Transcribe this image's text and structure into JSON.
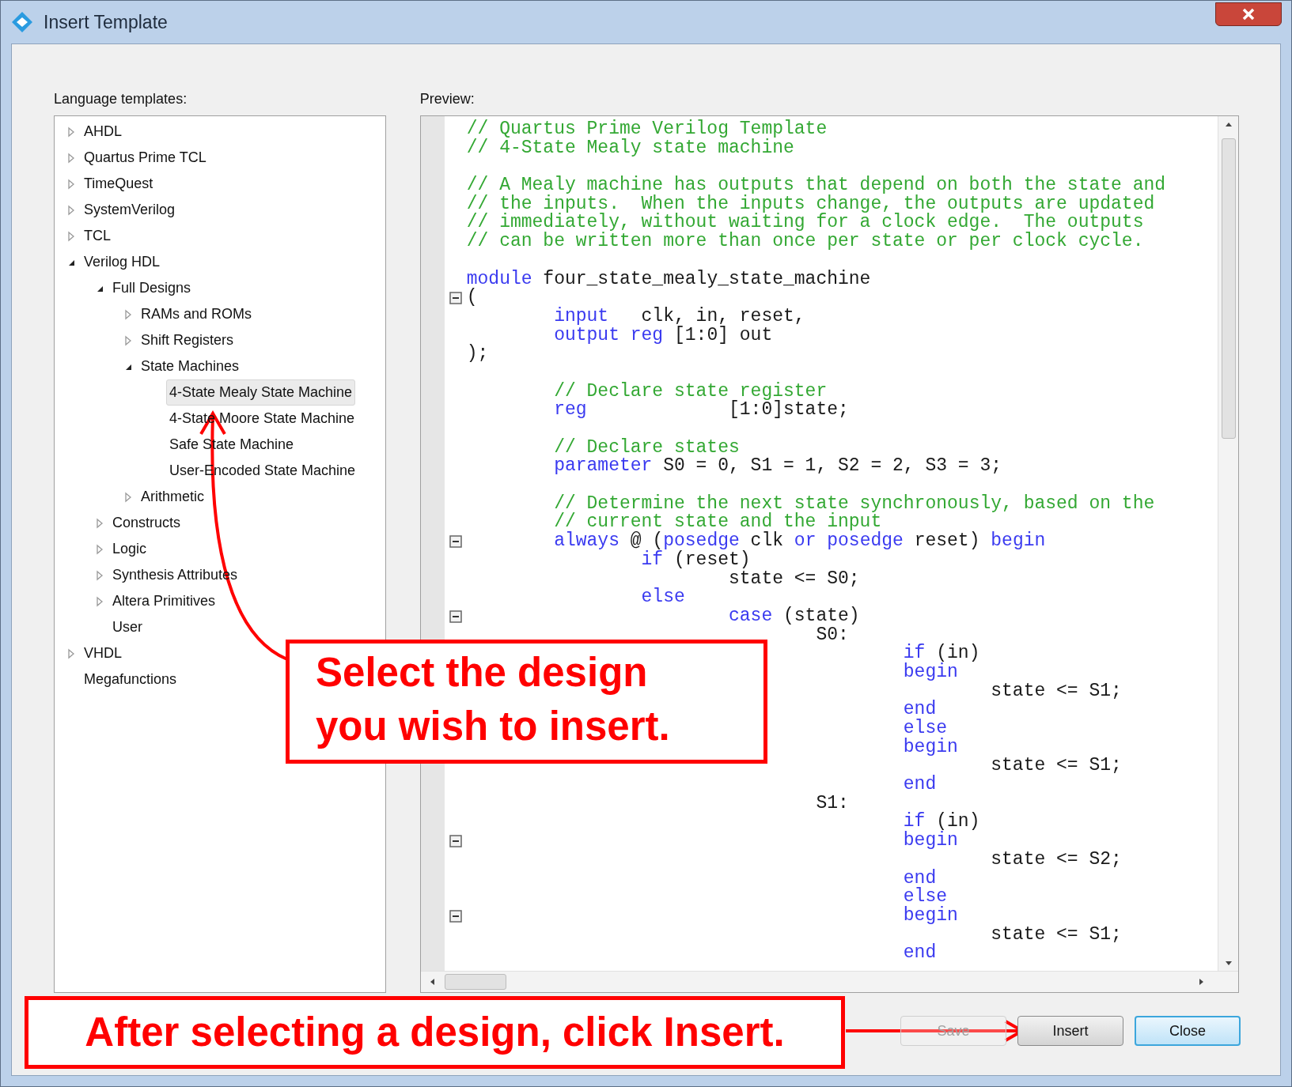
{
  "window": {
    "title": "Insert Template"
  },
  "tree": {
    "label": "Language templates:",
    "items": [
      {
        "label": "AHDL",
        "kind": "node",
        "expanded": false,
        "selected": false
      },
      {
        "label": "Quartus Prime TCL",
        "kind": "node",
        "expanded": false,
        "selected": false
      },
      {
        "label": "TimeQuest",
        "kind": "node",
        "expanded": false,
        "selected": false
      },
      {
        "label": "SystemVerilog",
        "kind": "node",
        "expanded": false,
        "selected": false
      },
      {
        "label": "TCL",
        "kind": "node",
        "expanded": false,
        "selected": false
      },
      {
        "label": "Verilog HDL",
        "kind": "node",
        "expanded": true,
        "selected": false,
        "children": [
          {
            "label": "Full Designs",
            "kind": "node",
            "expanded": true,
            "selected": false,
            "children": [
              {
                "label": "RAMs and ROMs",
                "kind": "node",
                "expanded": false,
                "selected": false
              },
              {
                "label": "Shift Registers",
                "kind": "node",
                "expanded": false,
                "selected": false
              },
              {
                "label": "State Machines",
                "kind": "node",
                "expanded": true,
                "selected": false,
                "children": [
                  {
                    "label": "4-State Mealy State Machine",
                    "kind": "leaf",
                    "selected": true
                  },
                  {
                    "label": "4-State Moore State Machine",
                    "kind": "leaf",
                    "selected": false
                  },
                  {
                    "label": "Safe State Machine",
                    "kind": "leaf",
                    "selected": false
                  },
                  {
                    "label": "User-Encoded State Machine",
                    "kind": "leaf",
                    "selected": false
                  }
                ]
              },
              {
                "label": "Arithmetic",
                "kind": "node",
                "expanded": false,
                "selected": false
              }
            ]
          },
          {
            "label": "Constructs",
            "kind": "node",
            "expanded": false,
            "selected": false
          },
          {
            "label": "Logic",
            "kind": "node",
            "expanded": false,
            "selected": false
          },
          {
            "label": "Synthesis Attributes",
            "kind": "node",
            "expanded": false,
            "selected": false
          },
          {
            "label": "Altera Primitives",
            "kind": "node",
            "expanded": false,
            "selected": false
          },
          {
            "label": "User",
            "kind": "leaf",
            "selected": false
          }
        ]
      },
      {
        "label": "VHDL",
        "kind": "node",
        "expanded": false,
        "selected": false
      },
      {
        "label": "Megafunctions",
        "kind": "leaf",
        "selected": false
      }
    ]
  },
  "preview": {
    "label": "Preview:",
    "lines": [
      {
        "kind": "code",
        "segments": [
          {
            "kind": "comment",
            "text": "// Quartus Prime Verilog Template"
          }
        ]
      },
      {
        "kind": "code",
        "segments": [
          {
            "kind": "comment",
            "text": "// 4-State Mealy state machine"
          }
        ]
      },
      {
        "kind": "blank"
      },
      {
        "kind": "code",
        "segments": [
          {
            "kind": "comment",
            "text": "// A Mealy machine has outputs that depend on both the state and"
          }
        ]
      },
      {
        "kind": "code",
        "segments": [
          {
            "kind": "comment",
            "text": "// the inputs.  When the inputs change, the outputs are updated"
          }
        ]
      },
      {
        "kind": "code",
        "segments": [
          {
            "kind": "comment",
            "text": "// immediately, without waiting for a clock edge.  The outputs"
          }
        ]
      },
      {
        "kind": "code",
        "segments": [
          {
            "kind": "comment",
            "text": "// can be written more than once per state or per clock cycle."
          }
        ]
      },
      {
        "kind": "blank"
      },
      {
        "kind": "code",
        "segments": [
          {
            "kind": "keyword",
            "text": "module"
          },
          {
            "kind": "plain",
            "text": " four_state_mealy_state_machine"
          }
        ]
      },
      {
        "kind": "code",
        "fold": true,
        "segments": [
          {
            "kind": "plain",
            "text": "("
          }
        ]
      },
      {
        "kind": "code",
        "segments": [
          {
            "kind": "keyword",
            "text": "        input"
          },
          {
            "kind": "plain",
            "text": "   clk, in, reset,"
          }
        ]
      },
      {
        "kind": "code",
        "segments": [
          {
            "kind": "keyword",
            "text": "        output reg"
          },
          {
            "kind": "plain",
            "text": " [1:0] out"
          }
        ]
      },
      {
        "kind": "code",
        "segments": [
          {
            "kind": "plain",
            "text": ");"
          }
        ]
      },
      {
        "kind": "blank"
      },
      {
        "kind": "code",
        "segments": [
          {
            "kind": "comment",
            "text": "        // Declare state register"
          }
        ]
      },
      {
        "kind": "code",
        "segments": [
          {
            "kind": "keyword",
            "text": "        reg"
          },
          {
            "kind": "plain",
            "text": "             [1:0]state;"
          }
        ]
      },
      {
        "kind": "blank"
      },
      {
        "kind": "code",
        "segments": [
          {
            "kind": "comment",
            "text": "        // Declare states"
          }
        ]
      },
      {
        "kind": "code",
        "segments": [
          {
            "kind": "keyword",
            "text": "        parameter"
          },
          {
            "kind": "plain",
            "text": " S0 = 0, S1 = 1, S2 = 2, S3 = 3;"
          }
        ]
      },
      {
        "kind": "blank"
      },
      {
        "kind": "code",
        "segments": [
          {
            "kind": "comment",
            "text": "        // Determine the next state synchronously, based on the"
          }
        ]
      },
      {
        "kind": "code",
        "segments": [
          {
            "kind": "comment",
            "text": "        // current state and the input"
          }
        ]
      },
      {
        "kind": "code",
        "fold": true,
        "segments": [
          {
            "kind": "keyword",
            "text": "        always"
          },
          {
            "kind": "plain",
            "text": " @ ("
          },
          {
            "kind": "keyword",
            "text": "posedge"
          },
          {
            "kind": "plain",
            "text": " clk "
          },
          {
            "kind": "keyword",
            "text": "or posedge"
          },
          {
            "kind": "plain",
            "text": " reset) "
          },
          {
            "kind": "keyword",
            "text": "begin"
          }
        ]
      },
      {
        "kind": "code",
        "segments": [
          {
            "kind": "keyword",
            "text": "                if"
          },
          {
            "kind": "plain",
            "text": " (reset)"
          }
        ]
      },
      {
        "kind": "code",
        "segments": [
          {
            "kind": "plain",
            "text": "                        state <= S0;"
          }
        ]
      },
      {
        "kind": "code",
        "segments": [
          {
            "kind": "keyword",
            "text": "                else"
          }
        ]
      },
      {
        "kind": "code",
        "fold": true,
        "segments": [
          {
            "kind": "keyword",
            "text": "                        case"
          },
          {
            "kind": "plain",
            "text": " (state)"
          }
        ]
      },
      {
        "kind": "code",
        "segments": [
          {
            "kind": "plain",
            "text": "                                S0:"
          }
        ]
      },
      {
        "kind": "code",
        "segments": [
          {
            "kind": "keyword",
            "text": "                                        if"
          },
          {
            "kind": "plain",
            "text": " (in)"
          }
        ]
      },
      {
        "kind": "code",
        "segments": [
          {
            "kind": "keyword",
            "text": "                                        begin"
          }
        ]
      },
      {
        "kind": "code",
        "segments": [
          {
            "kind": "plain",
            "text": "                                                state <= S1;"
          }
        ]
      },
      {
        "kind": "code",
        "segments": [
          {
            "kind": "keyword",
            "text": "                                        end"
          }
        ]
      },
      {
        "kind": "code",
        "segments": [
          {
            "kind": "keyword",
            "text": "                                        else"
          }
        ]
      },
      {
        "kind": "code",
        "segments": [
          {
            "kind": "keyword",
            "text": "                                        begin"
          }
        ]
      },
      {
        "kind": "code",
        "segments": [
          {
            "kind": "plain",
            "text": "                                                state <= S1;"
          }
        ]
      },
      {
        "kind": "code",
        "segments": [
          {
            "kind": "keyword",
            "text": "                                        end"
          }
        ]
      },
      {
        "kind": "code",
        "segments": [
          {
            "kind": "plain",
            "text": "                                S1:"
          }
        ]
      },
      {
        "kind": "code",
        "segments": [
          {
            "kind": "keyword",
            "text": "                                        if"
          },
          {
            "kind": "plain",
            "text": " (in)"
          }
        ]
      },
      {
        "kind": "code",
        "fold": true,
        "segments": [
          {
            "kind": "keyword",
            "text": "                                        begin"
          }
        ]
      },
      {
        "kind": "code",
        "segments": [
          {
            "kind": "plain",
            "text": "                                                state <= S2;"
          }
        ]
      },
      {
        "kind": "code",
        "segments": [
          {
            "kind": "keyword",
            "text": "                                        end"
          }
        ]
      },
      {
        "kind": "code",
        "segments": [
          {
            "kind": "keyword",
            "text": "                                        else"
          }
        ]
      },
      {
        "kind": "code",
        "fold": true,
        "segments": [
          {
            "kind": "keyword",
            "text": "                                        begin"
          }
        ]
      },
      {
        "kind": "code",
        "segments": [
          {
            "kind": "plain",
            "text": "                                                state <= S1;"
          }
        ]
      },
      {
        "kind": "code",
        "segments": [
          {
            "kind": "keyword",
            "text": "                                        end"
          }
        ]
      }
    ]
  },
  "buttons": [
    {
      "label": "Save",
      "disabled": true,
      "focused": false
    },
    {
      "label": "Insert",
      "disabled": false,
      "focused": false
    },
    {
      "label": "Close",
      "disabled": false,
      "focused": true
    }
  ],
  "callouts": [
    {
      "text": "Select the design you wish to insert."
    },
    {
      "text": "After selecting a design, click Insert."
    }
  ]
}
